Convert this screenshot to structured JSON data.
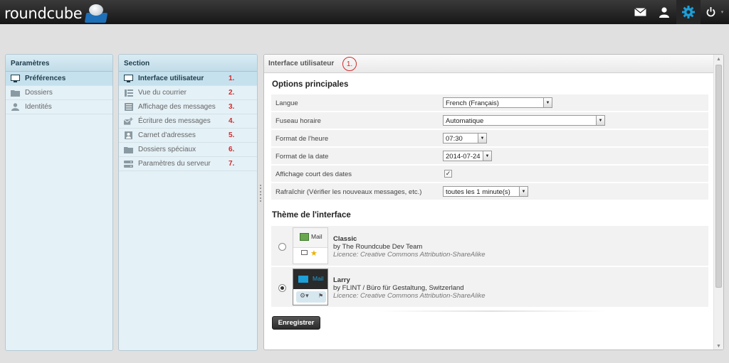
{
  "app": {
    "name": "roundcube"
  },
  "top_icons": [
    {
      "icon": "mail-icon"
    },
    {
      "icon": "user-icon"
    },
    {
      "icon": "gear-icon"
    },
    {
      "icon": "power-icon"
    }
  ],
  "settings_panel": {
    "title": "Paramètres",
    "items": [
      {
        "label": "Préférences",
        "icon": "monitor-icon"
      },
      {
        "label": "Dossiers",
        "icon": "folder-icon"
      },
      {
        "label": "Identités",
        "icon": "person-icon"
      }
    ]
  },
  "section_panel": {
    "title": "Section",
    "items": [
      {
        "label": "Interface utilisateur",
        "num": "1.",
        "icon": "monitor-icon"
      },
      {
        "label": "Vue du courrier",
        "num": "2.",
        "icon": "list-icon"
      },
      {
        "label": "Affichage des messages",
        "num": "3.",
        "icon": "message-icon"
      },
      {
        "label": "Écriture des messages",
        "num": "4.",
        "icon": "compose-icon"
      },
      {
        "label": "Carnet d'adresses",
        "num": "5.",
        "icon": "addressbook-icon"
      },
      {
        "label": "Dossiers spéciaux",
        "num": "6.",
        "icon": "folder-icon"
      },
      {
        "label": "Paramètres du serveur",
        "num": "7.",
        "icon": "server-icon"
      }
    ]
  },
  "content": {
    "title": "Interface utilisateur",
    "annotation": "1.",
    "main_options": {
      "title": "Options principales",
      "rows": [
        {
          "label": "Langue",
          "value": "French (Français)"
        },
        {
          "label": "Fuseau horaire",
          "value": "Automatique"
        },
        {
          "label": "Format de l'heure",
          "value": "07:30"
        },
        {
          "label": "Format de la date",
          "value": "2014-07-24"
        },
        {
          "label": "Affichage court des dates",
          "checked": true
        },
        {
          "label": "Rafraîchir (Vérifier les nouveaux messages, etc.)",
          "value": "toutes les 1 minute(s)"
        }
      ]
    },
    "theme": {
      "title": "Thème de l'interface",
      "skins": [
        {
          "name": "Classic",
          "author": "by The Roundcube Dev Team",
          "license": "Licence: Creative Commons Attribution-ShareAlike",
          "thumb_label": "Mail",
          "selected": false
        },
        {
          "name": "Larry",
          "author": "by FLINT / Büro für Gestaltung, Switzerland",
          "license": "Licence: Creative Commons Attribution-ShareAlike",
          "thumb_label": "Mail",
          "selected": true
        }
      ]
    },
    "save_label": "Enregistrer"
  },
  "colors": {
    "accent": "#1d9fd8",
    "annotation": "#d42a2a",
    "panel_bg": "#e4f1f7"
  }
}
